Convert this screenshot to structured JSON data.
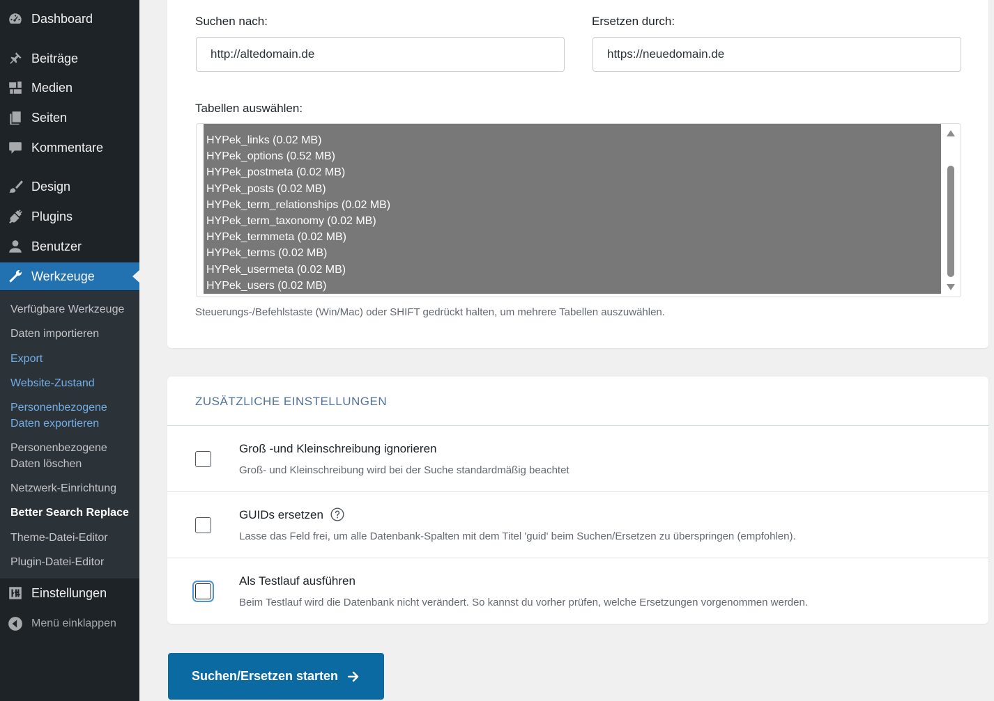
{
  "sidebar": {
    "items": [
      {
        "label": "Dashboard",
        "icon": "dashboard-icon"
      },
      {
        "label": "Beiträge",
        "icon": "pin-icon"
      },
      {
        "label": "Medien",
        "icon": "media-icon"
      },
      {
        "label": "Seiten",
        "icon": "pages-icon"
      },
      {
        "label": "Kommentare",
        "icon": "comment-icon"
      },
      {
        "label": "Design",
        "icon": "brush-icon"
      },
      {
        "label": "Plugins",
        "icon": "plug-icon"
      },
      {
        "label": "Benutzer",
        "icon": "user-icon"
      },
      {
        "label": "Werkzeuge",
        "icon": "wrench-icon"
      }
    ],
    "submenu": [
      "Verfügbare Werkzeuge",
      "Daten importieren",
      "Export",
      "Website-Zustand",
      "Personenbezogene Daten exportieren",
      "Personenbezogene Daten löschen",
      "Netzwerk-Einrichtung",
      "Better Search Replace",
      "Theme-Datei-Editor",
      "Plugin-Datei-Editor"
    ],
    "settings_label": "Einstellungen",
    "collapse_label": "Menü einklappen"
  },
  "search": {
    "search_label": "Suchen nach:",
    "search_value": "http://altedomain.de",
    "replace_label": "Ersetzen durch:",
    "replace_value": "https://neuedomain.de",
    "tables_label": "Tabellen auswählen:",
    "tables": [
      "HYPek_links (0.02 MB)",
      "HYPek_options (0.52 MB)",
      "HYPek_postmeta (0.02 MB)",
      "HYPek_posts (0.02 MB)",
      "HYPek_term_relationships (0.02 MB)",
      "HYPek_term_taxonomy (0.02 MB)",
      "HYPek_termmeta (0.02 MB)",
      "HYPek_terms (0.02 MB)",
      "HYPek_usermeta (0.02 MB)",
      "HYPek_users (0.02 MB)"
    ],
    "tables_hint": "Steuerungs-/Befehlstaste (Win/Mac) oder SHIFT gedrückt halten, um mehrere Tabellen auszuwählen."
  },
  "settings": {
    "title": "ZUSÄTZLICHE EINSTELLUNGEN",
    "options": [
      {
        "title": "Groß -und Kleinschreibung ignorieren",
        "desc": "Groß- und Kleinschreibung wird bei der Suche standardmäßig beachtet",
        "checked": false
      },
      {
        "title": "GUIDs ersetzen",
        "desc": "Lasse das Feld frei, um alle Datenbank-Spalten mit dem Titel 'guid' beim Suchen/Ersetzen zu überspringen (empfohlen).",
        "checked": false
      },
      {
        "title": "Als Testlauf ausführen",
        "desc": "Beim Testlauf wird die Datenbank nicht verändert. So kannst du vorher prüfen, welche Ersetzungen vorgenommen werden.",
        "checked": false
      }
    ]
  },
  "submit": {
    "label": "Suchen/Ersetzen starten",
    "icon": "arrow-right-icon"
  },
  "colors": {
    "sidebar": "#1d2327",
    "accent": "#2271b1",
    "button": "#0b6aa2",
    "selection": "#787878"
  }
}
